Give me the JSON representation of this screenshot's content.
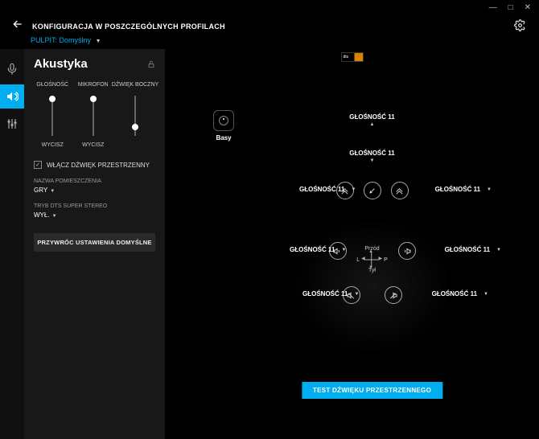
{
  "window": {
    "min": "—",
    "max": "□",
    "close": "✕"
  },
  "header": {
    "title": "KONFIGURACJA W POSZCZEGÓLNYCH PROFILACH",
    "profile_label": "PULPIT:",
    "profile_value": "Domyślny"
  },
  "sidebar": {
    "title": "Akustyka",
    "sliders": [
      {
        "label": "GŁOŚNOŚĆ",
        "mute": "WYCISZ",
        "pos": 0
      },
      {
        "label": "MIKROFON",
        "mute": "WYCISZ",
        "pos": 0
      },
      {
        "label": "DŹWIĘK BOCZNY",
        "mute": "",
        "pos": 35
      }
    ],
    "surround_checkbox": "WŁĄCZ DŹWIĘK PRZESTRZENNY",
    "room_label": "NAZWA POMIESZCZENIA",
    "room_value": "GRY",
    "dts_label": "TRYB DTS SUPER STEREO",
    "dts_value": "WYŁ.",
    "reset": "PRZYWRÓC USTAWIENIA DOMYŚLNE"
  },
  "content": {
    "dts_logo": "dts",
    "bass": "Basy",
    "volume_label": "GŁOŚNOŚĆ 11",
    "center": {
      "front": "Przód",
      "rear": "Tył",
      "left": "L",
      "right": "P"
    },
    "test": "TEST DŹWIĘKU PRZESTRZENNEGO"
  }
}
